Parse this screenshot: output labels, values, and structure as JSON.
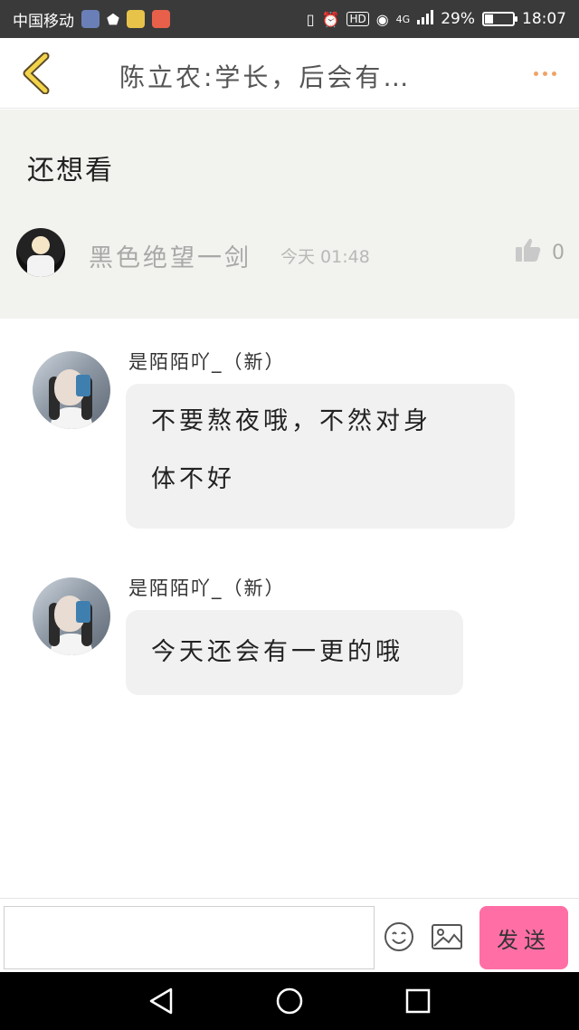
{
  "status_bar": {
    "carrier": "中国移动",
    "network": "4G",
    "battery_text": "29%",
    "battery_level": 0.29,
    "time": "18:07",
    "icons": [
      "vibrate-icon",
      "alarm-icon",
      "hd-icon",
      "eye-icon",
      "signal-icon",
      "battery-icon"
    ]
  },
  "header": {
    "title": "陈立农:学长，后会有…",
    "back_icon": "chevron-left-icon",
    "more_icon": "more-dots-icon",
    "accent_color": "#f0a366"
  },
  "original_comment": {
    "text": "还想看",
    "user": "黑色绝望一剑",
    "time": "今天 01:48",
    "like_count": "0"
  },
  "messages": [
    {
      "user": "是陌陌吖_（新）",
      "line1": "不要熬夜哦，不然对身",
      "line2": "体不好"
    },
    {
      "user": "是陌陌吖_（新）",
      "line1": "今天还会有一更的哦"
    }
  ],
  "input_bar": {
    "placeholder": "",
    "send_label": "发送",
    "send_color": "#ff6fa6"
  },
  "nav_bar": {
    "icons": [
      "back-triangle-icon",
      "home-circle-icon",
      "recents-square-icon"
    ]
  }
}
